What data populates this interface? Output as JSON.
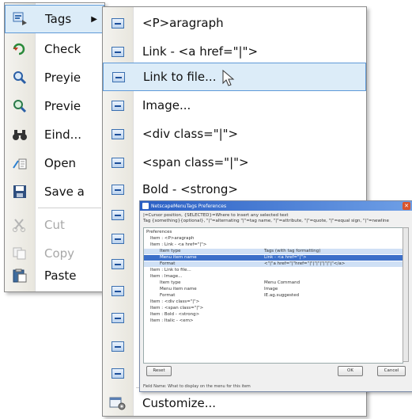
{
  "left_menu": {
    "items": [
      {
        "label": "Tags",
        "icon": "tags-icon",
        "submenu": true,
        "highlighted": true
      },
      {
        "label": "Check",
        "icon": "check-icon"
      },
      {
        "label": "Preyie",
        "icon": "preview-icon"
      },
      {
        "label": "Previe",
        "icon": "preview-alt-icon"
      },
      {
        "label": "Eind...",
        "icon": "binoculars-icon"
      },
      {
        "label": "Open",
        "icon": "open-icon"
      },
      {
        "label": "Save a",
        "icon": "save-icon"
      },
      {
        "label": "Cut",
        "icon": "scissors-icon",
        "disabled": true
      },
      {
        "label": "Copy",
        "icon": "copy-icon",
        "disabled": true
      },
      {
        "label": "Paste",
        "icon": "paste-icon"
      }
    ]
  },
  "right_menu": {
    "items": [
      {
        "label": "<P>aragraph"
      },
      {
        "label": "Link - <a href=\"|\">"
      },
      {
        "label": "Link to file...",
        "highlighted": true
      },
      {
        "label": "Image..."
      },
      {
        "label": "<div class=\"|\">"
      },
      {
        "label": "<span class=\"|\">"
      },
      {
        "label": "Bold - <strong>"
      },
      {
        "label": ""
      },
      {
        "label": ""
      },
      {
        "label": ""
      },
      {
        "label": ""
      },
      {
        "label": ""
      },
      {
        "label": ""
      },
      {
        "label": ""
      }
    ],
    "customize_label": "Customize..."
  },
  "dialog": {
    "title": "NetscapeMenuTags Preferences",
    "description_line1": "|=Cursor position, {SELECTED}=Where to insert any selected text",
    "description_line2": "Tag {something}{optional}, \"|\"=alternating \"|\"=tag name, \"|\"=attribute, \"|\"=quote, \"|\"=equal sign, \"|\"=newline",
    "tree_rows": [
      {
        "c1": "Preferences",
        "c2": "",
        "indent": 0
      },
      {
        "c1": "Item : <P>aragraph",
        "c2": "",
        "indent": 1
      },
      {
        "c1": "Item : Link - <a href=\"|\">",
        "c2": "",
        "indent": 1
      },
      {
        "c1": "Item type",
        "c2": "Tags (with tag formatting)",
        "indent": 2
      },
      {
        "c1": "Menu item name",
        "c2": "Link - <a href=\"|\">",
        "indent": 2,
        "state": "selstrong"
      },
      {
        "c1": "Format",
        "c2": "<\"|\"a href=\"|\"href=\"|\"|\"|\"|\"|\"|\"|\"</a>",
        "indent": 2
      },
      {
        "c1": "Item : Link to file...",
        "c2": "",
        "indent": 1
      },
      {
        "c1": "Item : Image...",
        "c2": "",
        "indent": 1
      },
      {
        "c1": "Item type",
        "c2": "Menu Command",
        "indent": 2
      },
      {
        "c1": "Menu item name",
        "c2": "Image",
        "indent": 2
      },
      {
        "c1": "Format",
        "c2": "IE.ag.suggested",
        "indent": 2
      },
      {
        "c1": "Item : <div class=\"|\">",
        "c2": "",
        "indent": 1
      },
      {
        "c1": "Item : <span class=\"|\">",
        "c2": "",
        "indent": 1
      },
      {
        "c1": "Item : Bold - <strong>",
        "c2": "",
        "indent": 1
      },
      {
        "c1": "Item : Italic - <em>",
        "c2": "",
        "indent": 1
      }
    ],
    "reset_label": "Reset",
    "ok_label": "OK",
    "cancel_label": "Cancel",
    "status_text": "Field Name: What to display on the menu for this item"
  },
  "colors": {
    "highlight_bg": "#dcecf8",
    "highlight_border": "#5f9ad8",
    "dialog_title": "#2a5fc4"
  }
}
